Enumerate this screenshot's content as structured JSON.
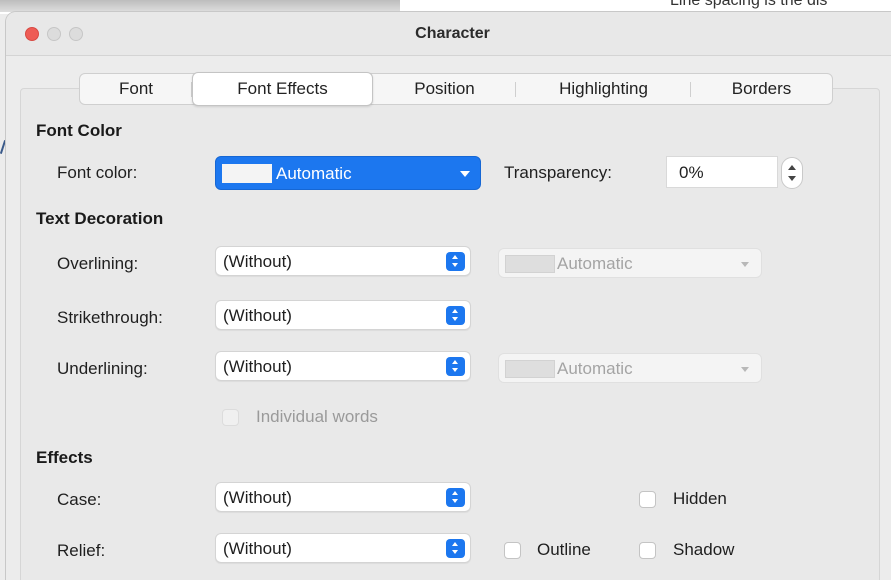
{
  "background": {
    "snippet": "Line spacing is the dis"
  },
  "window": {
    "title": "Character"
  },
  "tabs": [
    {
      "label": "Font"
    },
    {
      "label": "Font Effects"
    },
    {
      "label": "Position"
    },
    {
      "label": "Highlighting"
    },
    {
      "label": "Borders"
    }
  ],
  "font_color": {
    "heading": "Font Color",
    "label": "Font color:",
    "value": "Automatic",
    "transparency_label": "Transparency:",
    "transparency_value": "0%"
  },
  "text_decoration": {
    "heading": "Text Decoration",
    "overlining": {
      "label": "Overlining:",
      "value": "(Without)",
      "color": "Automatic"
    },
    "strikethrough": {
      "label": "Strikethrough:",
      "value": "(Without)"
    },
    "underlining": {
      "label": "Underlining:",
      "value": "(Without)",
      "color": "Automatic"
    },
    "individual_words": {
      "label": "Individual words",
      "checked": false,
      "enabled": false
    }
  },
  "effects": {
    "heading": "Effects",
    "case": {
      "label": "Case:",
      "value": "(Without)"
    },
    "relief": {
      "label": "Relief:",
      "value": "(Without)"
    },
    "hidden": {
      "label": "Hidden",
      "checked": false
    },
    "outline": {
      "label": "Outline",
      "checked": false
    },
    "shadow": {
      "label": "Shadow",
      "checked": false
    }
  },
  "colors": {
    "accent": "#1c77ef",
    "close": "#ee5c55"
  }
}
